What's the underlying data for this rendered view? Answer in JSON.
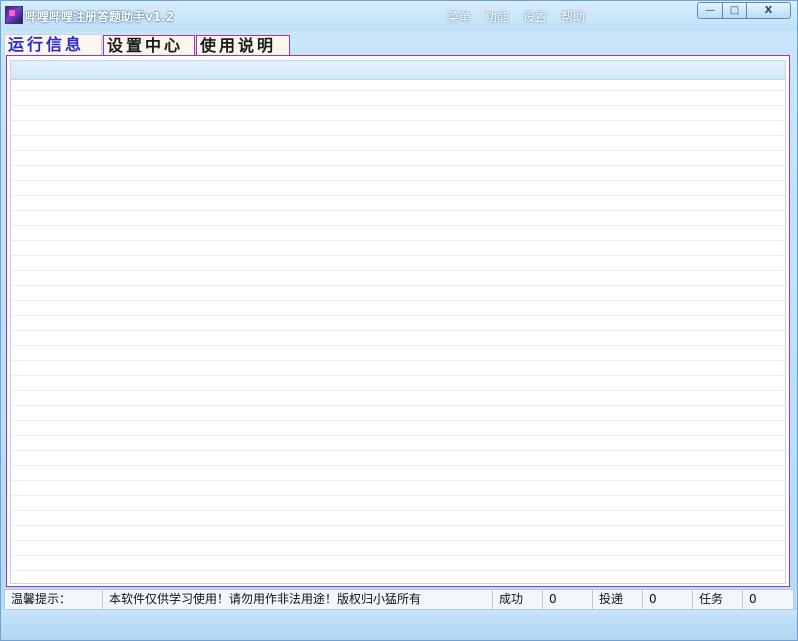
{
  "window": {
    "title": "哔哩哔哩注册答题助手v1.2",
    "app_icon": "app-logo-icon",
    "controls": {
      "minimize": "—",
      "maximize": "□",
      "close": "X"
    }
  },
  "menu": [
    "菜单",
    "功能",
    "设置",
    "帮助"
  ],
  "tabs": [
    {
      "label": "运行信息",
      "active": true
    },
    {
      "label": "设置中心",
      "active": false
    },
    {
      "label": "使用说明",
      "active": false
    }
  ],
  "status": {
    "tip_label": "温馨提示：",
    "tip_text": "本软件仅供学习使用！请勿用作非法用途！版权归小猛所有",
    "success_label": "成功",
    "success_value": "0",
    "delivered_label": "投递",
    "delivered_value": "0",
    "tasks_label": "任务",
    "tasks_value": "0"
  },
  "colors": {
    "tab_active_text": "#2a2ad0",
    "panel_border": "#b030a8",
    "titlebar": "#bfe0f8"
  }
}
